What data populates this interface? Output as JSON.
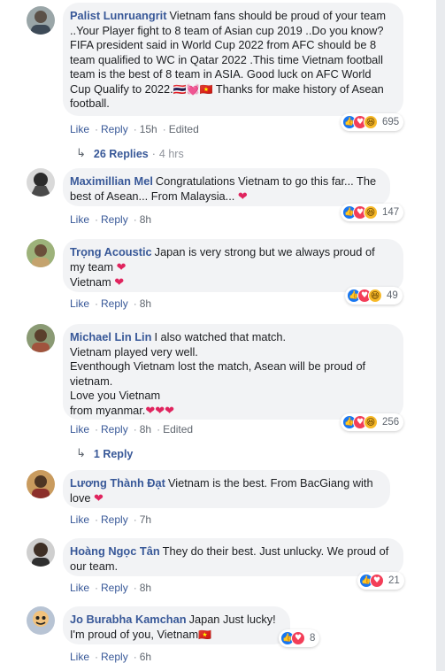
{
  "comments": [
    {
      "name": "Palist Lunruangrit",
      "text": "Vietnam fans should be proud of your team ..Your Player fight to 8 team of Asian cup 2019 ..Do you know? FIFA president said in World Cup 2022 from AFC should be 8 team qualified to WC in Qatar 2022 .This time Vietnam football team is the best of 8 team in ASIA. Good luck on AFC World Cup Qualify to 2022.",
      "emoji": "🇹🇭💓🇻🇳",
      "text_after": " Thanks for make history of Asean football.",
      "actions": {
        "like": "Like",
        "reply": "Reply",
        "time": "15h",
        "edited": "Edited"
      },
      "reaction_count": "695",
      "replies": {
        "label": "26 Replies",
        "time": "4 hrs"
      },
      "avatar_color": "#9aa6a8"
    },
    {
      "name": "Maximillian Mel",
      "text": "Congratulations Vietnam to go this far... The best of Asean... From Malaysia...",
      "emoji": "❤",
      "actions": {
        "like": "Like",
        "reply": "Reply",
        "time": "8h"
      },
      "reaction_count": "147",
      "avatar_color": "#4a4a4a"
    },
    {
      "name": "Trọng Acoustic",
      "text": "Japan is very strong but we always proud of my team",
      "emoji": "❤",
      "line2": "Vietnam",
      "emoji2": "❤",
      "actions": {
        "like": "Like",
        "reply": "Reply",
        "time": "8h"
      },
      "reaction_count": "49",
      "avatar_color": "#7a8f5a"
    },
    {
      "name": "Michael Lin Lin",
      "text": "I also watched that match.\nVietnam played very well.\nEventhough Vietnam lost the match, Asean will be proud of vietnam.\nLove you Vietnam\nfrom myanmar.",
      "emoji": "❤❤❤",
      "actions": {
        "like": "Like",
        "reply": "Reply",
        "time": "8h",
        "edited": "Edited"
      },
      "reaction_count": "256",
      "replies": {
        "label": "1 Reply"
      },
      "avatar_color": "#8a6d4b"
    },
    {
      "name": "Lương Thành Đạt",
      "text": "Vietnam is the best. From BacGiang with love",
      "emoji": "❤",
      "actions": {
        "like": "Like",
        "reply": "Reply",
        "time": "7h"
      },
      "avatar_color": "#b07a3e"
    },
    {
      "name": "Hoàng Ngọc Tân",
      "text": "They do their best. Just unlucky. We proud of our team.",
      "actions": {
        "like": "Like",
        "reply": "Reply",
        "time": "8h"
      },
      "reaction_count": "21",
      "avatar_color": "#5b4a3a"
    },
    {
      "name": "Jo Burabha Kamchan",
      "text": "Japan Just lucky!\nI'm proud of you, Vietnam",
      "emoji": "🇻🇳",
      "actions": {
        "like": "Like",
        "reply": "Reply",
        "time": "6h"
      },
      "reaction_count": "8",
      "avatar_color": "#6a7d96"
    }
  ],
  "icons": {
    "like": "thumbs-up-icon",
    "love": "heart-icon",
    "haha": "laughing-face-icon",
    "reply_arrow": "reply-arrow-icon"
  },
  "colors": {
    "link": "#385898",
    "bubble": "#f2f3f5",
    "like": "#1877f2",
    "love": "#f33e58",
    "haha": "#f7b928"
  }
}
